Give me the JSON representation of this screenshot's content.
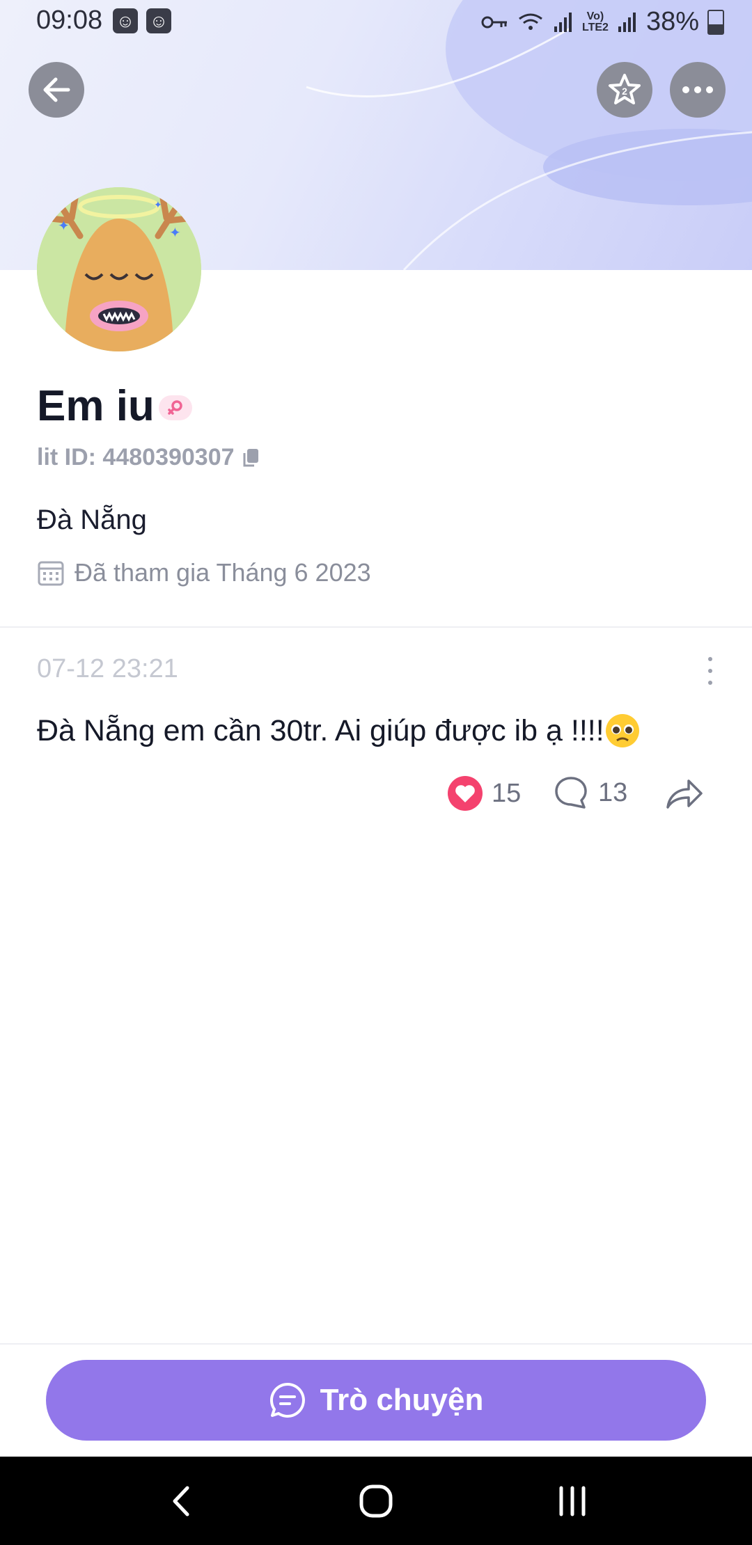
{
  "status_bar": {
    "time": "09:08",
    "battery": "38%"
  },
  "header": {
    "back_icon": "arrow-left-icon",
    "favorite_icon": "star-icon",
    "more_icon": "ellipsis-icon"
  },
  "profile": {
    "name": "Em iu",
    "gender_icon": "female-icon",
    "lit_id": "lit ID: 4480390307",
    "location": "Đà Nẵng",
    "joined": "Đã tham gia Tháng 6 2023"
  },
  "post": {
    "time": "07-12 23:21",
    "text": "Đà Nẵng em cần 30tr. Ai giúp được ib ạ !!!!",
    "likes": "15",
    "comments": "13"
  },
  "actions": {
    "chat_label": "Trò chuyện"
  },
  "colors": {
    "accent": "#9277ea",
    "like": "#f4426e",
    "banner": "#d9ddfa"
  }
}
